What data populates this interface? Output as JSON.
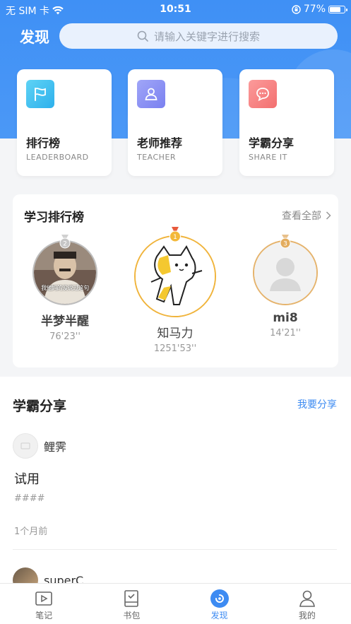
{
  "status_bar": {
    "carrier": "无 SIM 卡",
    "time": "10:51",
    "battery": "77%",
    "battery_level": 0.77
  },
  "header": {
    "title": "发现",
    "search_placeholder": "请输入关键字进行搜索"
  },
  "quick_cards": [
    {
      "title": "排行榜",
      "subtitle": "LEADERBOARD",
      "icon": "flag-icon",
      "color": "#35c0f0"
    },
    {
      "title": "老师推荐",
      "subtitle": "TEACHER",
      "icon": "teacher-icon",
      "color": "#8a90f5"
    },
    {
      "title": "学霸分享",
      "subtitle": "SHARE IT",
      "icon": "chat-bubble-icon",
      "color": "#f57f7f"
    }
  ],
  "leaderboard": {
    "title": "学习排行榜",
    "view_all": "查看全部",
    "rankers": [
      {
        "rank": 2,
        "name": "半梦半醒",
        "time": "76'23''",
        "avatar_caption": "我他妈的没说过这句"
      },
      {
        "rank": 1,
        "name": "知马力",
        "time": "1251'53''"
      },
      {
        "rank": 3,
        "name": "mi8",
        "time": "14'21''"
      }
    ]
  },
  "share": {
    "title": "学霸分享",
    "action": "我要分享",
    "posts": [
      {
        "user": "鲤霁",
        "title": "试用",
        "body": "####",
        "time": "1个月前"
      },
      {
        "user": "superC"
      }
    ]
  },
  "tabbar": [
    {
      "label": "笔记",
      "icon": "play-square-icon",
      "active": false
    },
    {
      "label": "书包",
      "icon": "checkbook-icon",
      "active": false
    },
    {
      "label": "发现",
      "icon": "discover-icon",
      "active": true
    },
    {
      "label": "我的",
      "icon": "user-icon",
      "active": false
    }
  ],
  "colors": {
    "primary": "#3d8bf2",
    "gold": "#f0b43c",
    "silver": "#bbbbbb",
    "bronze": "#e5b36c"
  }
}
